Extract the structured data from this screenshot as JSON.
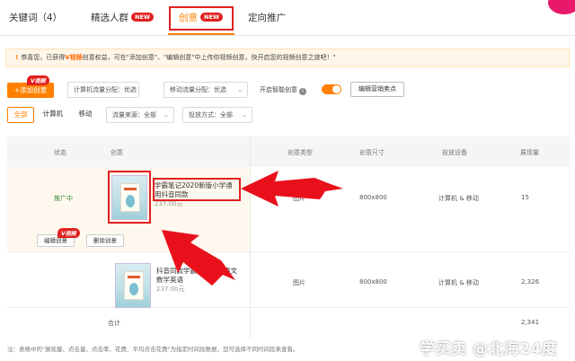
{
  "tabs": [
    {
      "label": "关键词（4）",
      "badge": ""
    },
    {
      "label": "精选人群",
      "badge": "NEW"
    },
    {
      "label": "创意",
      "badge": "NEW"
    },
    {
      "label": "定向推广",
      "badge": ""
    }
  ],
  "notice": {
    "text_a": "恭喜您，已获得",
    "v_label": "V视频",
    "text_b": "创意权益，可在\"添加创意\"、\"编辑创意\"中上传你视频创意，快开启您的视频创意之旅吧！\""
  },
  "toolbar": {
    "add_label": "+添加创意",
    "v_badge": "V视频",
    "pc_traffic": {
      "label": "计算机流量分配：",
      "value": "优选"
    },
    "mobile_traffic": {
      "label": "移动流量分配：",
      "value": "优选"
    },
    "smart_label": "开启智能创意",
    "smart_on": true,
    "edit_selling_label": "编辑营销卖点"
  },
  "filters": {
    "segments": [
      "全部",
      "计算机",
      "移动"
    ],
    "source": {
      "label": "流量来源：",
      "value": "全部"
    },
    "method": {
      "label": "投放方式：",
      "value": "全部"
    }
  },
  "table": {
    "headers": [
      "状态",
      "创意",
      "创意类型",
      "创意尺寸",
      "投放设备",
      "展现量"
    ],
    "rows": [
      {
        "status": "推广中",
        "title_line1": "学霸笔记2020新版小学通",
        "title_line2": "用抖音同款",
        "price": "237.00元",
        "type": "图片",
        "size": "800x800",
        "device": "计算机 & 移动",
        "impressions": "15",
        "v_badge": "V视频",
        "edit_label": "编辑创意",
        "delete_label": "删除创意"
      },
      {
        "status": "",
        "title_line1": "抖音同款学霸笔记小学语文",
        "title_line2": "数学英语",
        "price": "237.00元",
        "type": "图片",
        "size": "800x800",
        "device": "计算机 & 移动",
        "impressions": "2,326"
      }
    ],
    "total_label": "合计",
    "total_impressions": "2,341"
  },
  "footnote": "注：表格中的\"展现量、点击量、点击率、花费、平均点击花费\"为指定时间段数据，您可选择不同时间段来查看。",
  "watermark": "学买卖 @北海24度",
  "colors": {
    "accent": "#ff8000",
    "highlight": "#e02020",
    "status_green": "#3a8a3a"
  }
}
